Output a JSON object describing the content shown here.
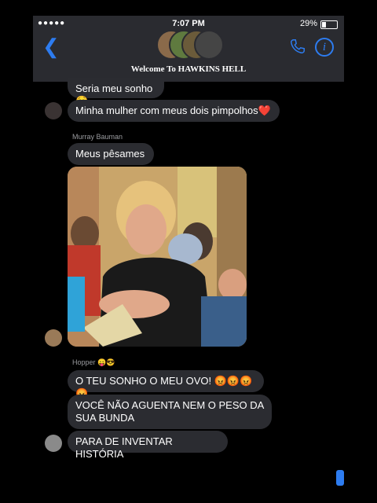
{
  "status_bar": {
    "signal": "●●●●● ",
    "time": "7:07 PM",
    "battery_percent": "29%"
  },
  "header": {
    "group_title": "Welcome To HAWKINS HELL"
  },
  "messages": [
    {
      "text": "Seria meu sonho 🤤"
    },
    {
      "text": "Minha mulher com meus dois pimpolhos❤️"
    },
    {
      "sender": "Murray Bauman",
      "text": "Meus pêsames"
    },
    {
      "sender": "Hopper 😛😎",
      "text": "O TEU SONHO O MEU OVO! 😡😡😡😡"
    },
    {
      "text": "VOCÊ NÃO AGUENTA NEM O PESO DA SUA BUNDA"
    },
    {
      "text": "PARA DE INVENTAR HISTÓRIA"
    }
  ],
  "colors": {
    "accent": "#2d7cf0",
    "bubble": "#2b2c31",
    "header": "#2a2b30"
  }
}
